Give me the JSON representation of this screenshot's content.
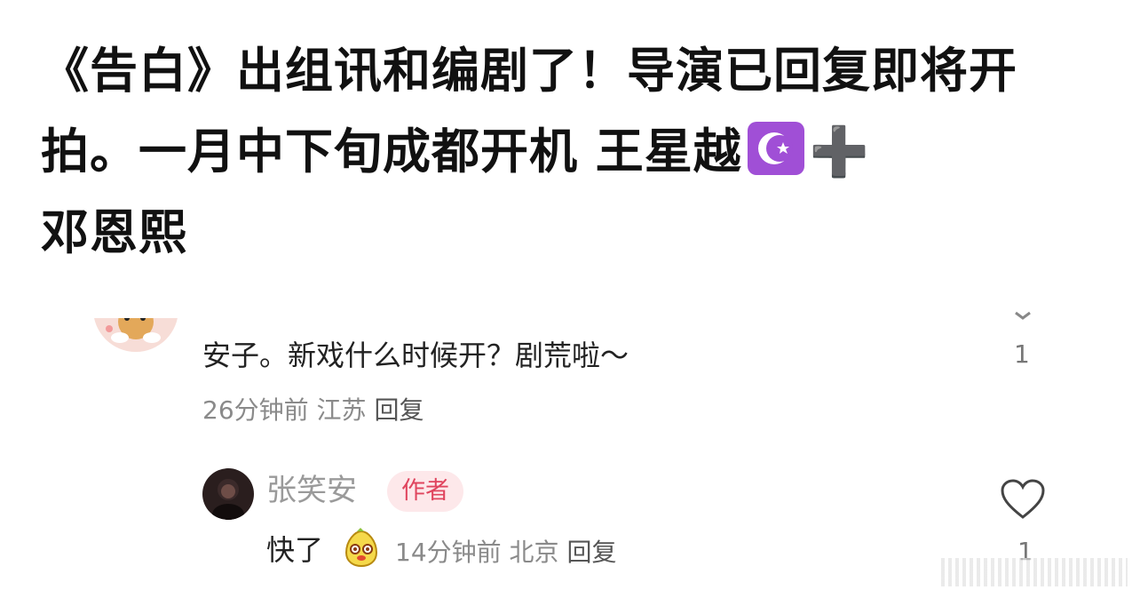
{
  "post": {
    "headline_part1": "《告白》出组讯和编剧了！导演已回复即将开拍。一月中下旬成都开机 王星越",
    "headline_part2": "邓恩熙",
    "plus": "➕"
  },
  "comment": {
    "text": "安子。新戏什么时候开？剧荒啦～",
    "likes": "1",
    "time": "26分钟前",
    "location": "江苏",
    "reply_label": "回复"
  },
  "reply": {
    "author": "张笑安",
    "badge": "作者",
    "text": "快了",
    "likes": "1",
    "time": "14分钟前",
    "location": "北京",
    "reply_label": "回复"
  },
  "colors": {
    "badge_bg": "#fde8ea",
    "badge_text": "#e0455e",
    "moon_emoji_bg": "#a04fd6"
  },
  "icons": [
    "star-and-crescent-emoji-icon",
    "heart-icon",
    "chevron-down-icon",
    "sticker-icon"
  ]
}
